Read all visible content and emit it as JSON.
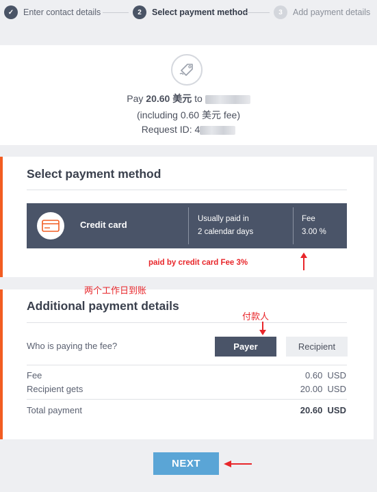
{
  "stepper": {
    "steps": [
      {
        "number": "✓",
        "label": "Enter contact details",
        "state": "done"
      },
      {
        "number": "2",
        "label": "Select payment method",
        "state": "active"
      },
      {
        "number": "3",
        "label": "Add payment details",
        "state": "todo"
      }
    ]
  },
  "summary": {
    "pay_prefix": "Pay ",
    "amount": "20.60 美元",
    "to_text": " to ",
    "fee_line": "(including 0.60 美元 fee)",
    "request_prefix": "Request ID: 4"
  },
  "payment_method": {
    "title": "Select payment method",
    "method_name": "Credit card",
    "timing_line1": "Usually paid in",
    "timing_line2": "2 calendar days",
    "fee_label": "Fee",
    "fee_value": "3.00 %"
  },
  "annotations": {
    "fee_note": "paid by credit card Fee 3%",
    "two_days_note": "两个工作日到账",
    "payer_note": "付款人"
  },
  "details": {
    "title": "Additional payment details",
    "question": "Who is paying the fee?",
    "payer_label": "Payer",
    "recipient_label": "Recipient",
    "fee_label": "Fee",
    "fee_value": "0.60",
    "fee_currency": "USD",
    "recipient_gets_label": "Recipient gets",
    "recipient_gets_value": "20.00",
    "recipient_gets_currency": "USD",
    "total_label": "Total payment",
    "total_value": "20.60",
    "total_currency": "USD"
  },
  "actions": {
    "next_label": "NEXT"
  },
  "colors": {
    "accent_orange": "#f25d22",
    "dark_slate": "#4a5468",
    "next_blue": "#5aa5d6",
    "annotation_red": "#e8262a"
  }
}
